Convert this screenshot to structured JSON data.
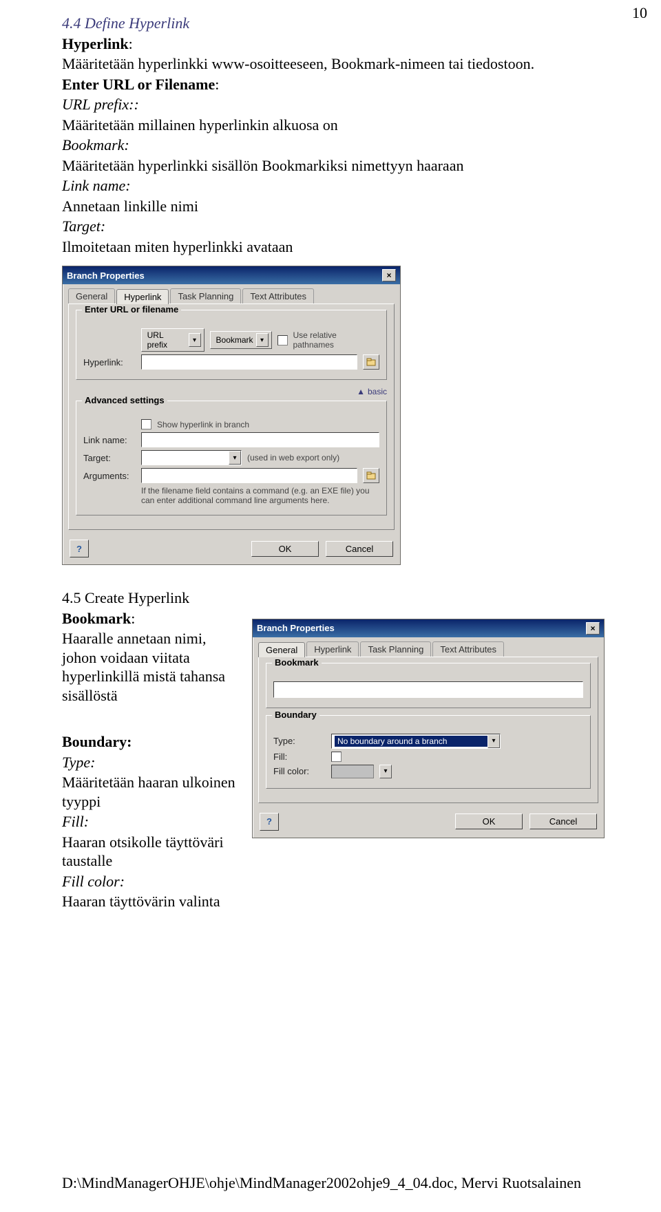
{
  "page_number": "10",
  "sec44_title": "4.4 Define Hyperlink",
  "hyperlink_label": "Hyperlink",
  "hyperlink_desc": "Määritetään hyperlinkki www-osoitteeseen, Bookmark-nimeen tai tiedostoon.",
  "enter_url_label": "Enter URL or Filename",
  "url_prefix_label": "URL prefix:",
  "url_prefix_desc": "Määritetään millainen hyperlinkin alkuosa on",
  "bookmark_label": "Bookmark",
  "bookmark_desc": "Määritetään hyperlinkki sisällön Bookmarkiksi nimettyyn haaraan",
  "link_name_label": "Link name",
  "link_name_desc": "Annetaan linkille nimi",
  "target_label": "Target",
  "target_desc": "Ilmoitetaan miten hyperlinkki avataan",
  "sec45_title": "4.5 Create Hyperlink",
  "bookmark2_label": "Bookmark",
  "bookmark2_desc": "Haaralle annetaan nimi, johon voidaan viitata hyperlinkillä mistä tahansa sisällöstä",
  "boundary_label": "Boundary:",
  "type_label": "Type",
  "type_desc": "Määritetään haaran ulkoinen tyyppi",
  "fill_label": "Fill",
  "fill_desc": "Haaran otsikolle täyttöväri taustalle",
  "fillcolor_label": "Fill color",
  "fillcolor_desc": "Haaran täyttövärin valinta",
  "footer_text": "D:\\MindManagerOHJE\\ohje\\MindManager2002ohje9_4_04.doc, Mervi Ruotsalainen",
  "colon": ":",
  "dlg1": {
    "title": "Branch Properties",
    "tabs": [
      "General",
      "Hyperlink",
      "Task Planning",
      "Text Attributes"
    ],
    "group1_legend": "Enter URL or filename",
    "url_prefix_btn": "URL prefix",
    "bookmark_btn": "Bookmark",
    "use_relative": "Use relative pathnames",
    "hyperlink_lbl": "Hyperlink:",
    "basic": "basic",
    "group2_legend": "Advanced settings",
    "show_hyperlink": "Show hyperlink in branch",
    "link_name_lbl": "Link name:",
    "target_lbl": "Target:",
    "target_hint": "(used in web export only)",
    "arguments_lbl": "Arguments:",
    "args_hint": "If the filename field contains a command (e.g. an EXE file) you can enter additional command line arguments here.",
    "ok": "OK",
    "cancel": "Cancel"
  },
  "dlg2": {
    "title": "Branch Properties",
    "tabs": [
      "General",
      "Hyperlink",
      "Task Planning",
      "Text Attributes"
    ],
    "bookmark_legend": "Bookmark",
    "boundary_legend": "Boundary",
    "type_lbl": "Type:",
    "type_value": "No boundary around a branch",
    "fill_lbl": "Fill:",
    "fillcolor_lbl": "Fill color:",
    "ok": "OK",
    "cancel": "Cancel"
  }
}
